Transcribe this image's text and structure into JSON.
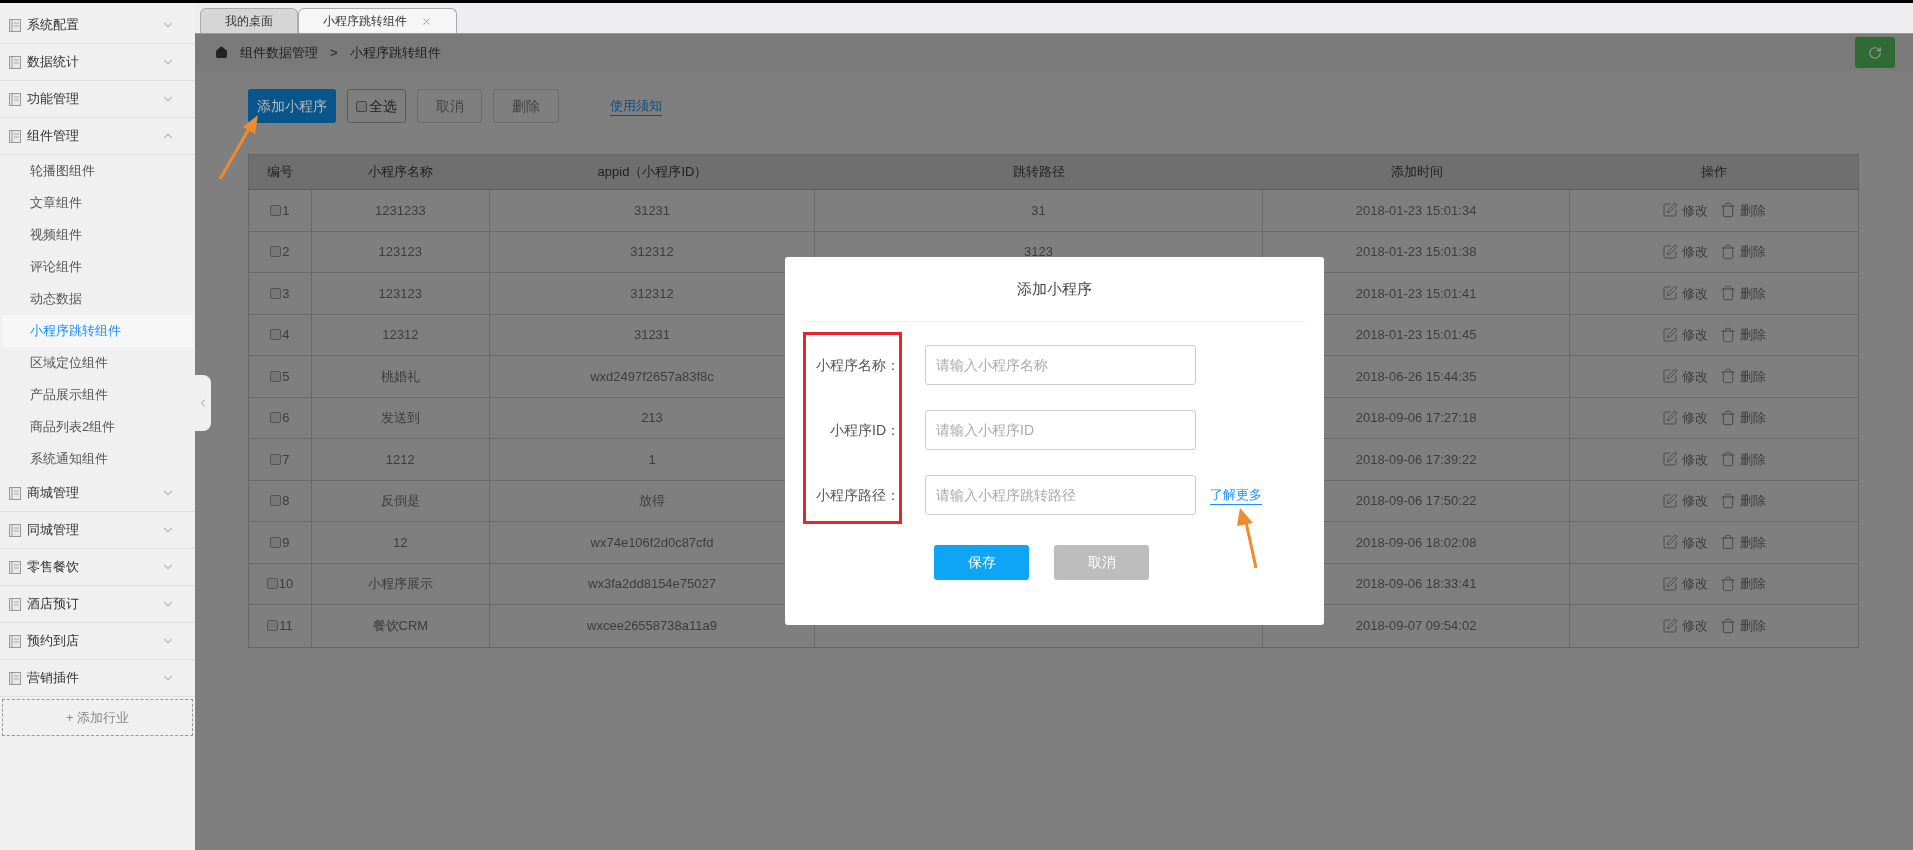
{
  "sidebar": {
    "groups": [
      {
        "label": "系统配置",
        "expanded": false
      },
      {
        "label": "数据统计",
        "expanded": false
      },
      {
        "label": "功能管理",
        "expanded": false
      },
      {
        "label": "组件管理",
        "expanded": true,
        "items": [
          {
            "label": "轮播图组件",
            "selected": false
          },
          {
            "label": "文章组件",
            "selected": false
          },
          {
            "label": "视频组件",
            "selected": false
          },
          {
            "label": "评论组件",
            "selected": false
          },
          {
            "label": "动态数据",
            "selected": false
          },
          {
            "label": "小程序跳转组件",
            "selected": true
          },
          {
            "label": "区域定位组件",
            "selected": false
          },
          {
            "label": "产品展示组件",
            "selected": false
          },
          {
            "label": "商品列表2组件",
            "selected": false
          },
          {
            "label": "系统通知组件",
            "selected": false
          }
        ]
      },
      {
        "label": "商城管理",
        "expanded": false
      },
      {
        "label": "同城管理",
        "expanded": false
      },
      {
        "label": "零售餐饮",
        "expanded": false
      },
      {
        "label": "酒店预订",
        "expanded": false
      },
      {
        "label": "预约到店",
        "expanded": false
      },
      {
        "label": "营销插件",
        "expanded": false
      }
    ],
    "add_button": "+ 添加行业"
  },
  "tabs": [
    {
      "label": "我的桌面",
      "selected": false
    },
    {
      "label": "小程序跳转组件",
      "selected": true
    }
  ],
  "breadcrumb": {
    "items": [
      "组件数据管理",
      "小程序跳转组件"
    ],
    "separator": ">"
  },
  "toolbar": {
    "add": "添加小程序",
    "select_all": {
      "label": "全选",
      "checked": false
    },
    "cancel": "取消",
    "delete": "删除",
    "help_link": "使用须知"
  },
  "table": {
    "columns": [
      "编号",
      "小程序名称",
      "appid（小程序ID）",
      "跳转路径",
      "添加时间",
      "操作"
    ],
    "rows": [
      {
        "number": "1",
        "checked": false,
        "name": "1231233",
        "appid": "31231",
        "path": "31",
        "time": "2018-01-23 15:01:34",
        "edit": "修改",
        "delete": "删除"
      },
      {
        "number": "2",
        "checked": false,
        "name": "123123",
        "appid": "312312",
        "path": "3123",
        "time": "2018-01-23 15:01:38",
        "edit": "修改",
        "delete": "删除"
      },
      {
        "number": "3",
        "checked": false,
        "name": "123123",
        "appid": "312312",
        "time": "2018-01-23 15:01:41",
        "edit": "修改",
        "delete": "删除"
      },
      {
        "number": "4",
        "checked": false,
        "name": "12312",
        "appid": "31231",
        "time": "2018-01-23 15:01:45",
        "edit": "修改",
        "delete": "删除"
      },
      {
        "number": "5",
        "checked": false,
        "name": "桃婚礼",
        "appid": "wxd2497f2657a83f8c",
        "time": "2018-06-26 15:44:35",
        "edit": "修改",
        "delete": "删除"
      },
      {
        "number": "6",
        "checked": false,
        "name": "发送到",
        "appid": "213",
        "time": "2018-09-06 17:27:18",
        "edit": "修改",
        "delete": "删除"
      },
      {
        "number": "7",
        "checked": false,
        "name": "1212",
        "appid": "1",
        "time": "2018-09-06 17:39:22",
        "edit": "修改",
        "delete": "删除"
      },
      {
        "number": "8",
        "checked": false,
        "name": "反倒是",
        "appid": "放得",
        "time": "2018-09-06 17:50:22",
        "edit": "修改",
        "delete": "删除"
      },
      {
        "number": "9",
        "checked": false,
        "name": "12",
        "appid": "wx74e106f2d0c87cfd",
        "time": "2018-09-06 18:02:08",
        "edit": "修改",
        "delete": "删除"
      },
      {
        "number": "10",
        "checked": false,
        "name": "小程序展示",
        "appid": "wx3fa2dd8154e75027",
        "time": "2018-09-06 18:33:41",
        "edit": "修改",
        "delete": "删除"
      },
      {
        "number": "11",
        "checked": false,
        "name": "餐饮CRM",
        "appid": "wxcee26558738a11a9",
        "time": "2018-09-07 09:54:02",
        "edit": "修改",
        "delete": "删除"
      }
    ]
  },
  "dialog": {
    "title": "添加小程序",
    "fields": [
      {
        "label": "小程序名称：",
        "placeholder": "请输入小程序名称"
      },
      {
        "label": "小程序ID：",
        "placeholder": "请输入小程序ID"
      },
      {
        "label": "小程序路径：",
        "placeholder": "请输入小程序跳转路径",
        "link": "了解更多"
      }
    ],
    "buttons": [
      {
        "label": "保存",
        "kind": "primary"
      },
      {
        "label": "取消",
        "kind": "secondary"
      }
    ]
  }
}
